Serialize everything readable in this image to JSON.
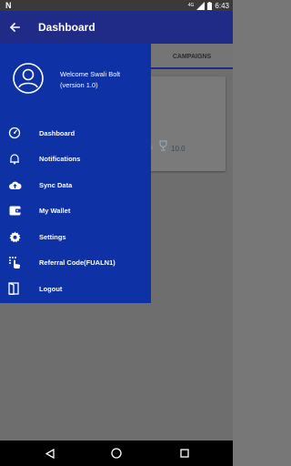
{
  "status_bar": {
    "time": "6:43",
    "network_label": "4G"
  },
  "app_bar": {
    "title": "Dashboard"
  },
  "tabs": {
    "visible_tab": "CAMPAIGNS"
  },
  "card": {
    "score": "10.0"
  },
  "drawer": {
    "welcome_line1": "Welcome Swali Bolt",
    "welcome_line2": "(version 1.0)",
    "items": [
      {
        "label": "Dashboard",
        "icon": "speedometer-icon"
      },
      {
        "label": "Notifications",
        "icon": "bell-icon"
      },
      {
        "label": "Sync Data",
        "icon": "cloud-upload-icon"
      },
      {
        "label": "My Wallet",
        "icon": "wallet-icon"
      },
      {
        "label": "Settings",
        "icon": "gear-icon"
      },
      {
        "label": "Referral Code(FUALN1)",
        "icon": "touch-app-icon"
      },
      {
        "label": "Logout",
        "icon": "logout-icon"
      }
    ]
  },
  "colors": {
    "app_bar": "#1f2b86",
    "drawer": "#0e31a6",
    "scrim": "#6e6e6e",
    "status_bar": "#3a3a3a",
    "nav_bar": "#000000"
  }
}
